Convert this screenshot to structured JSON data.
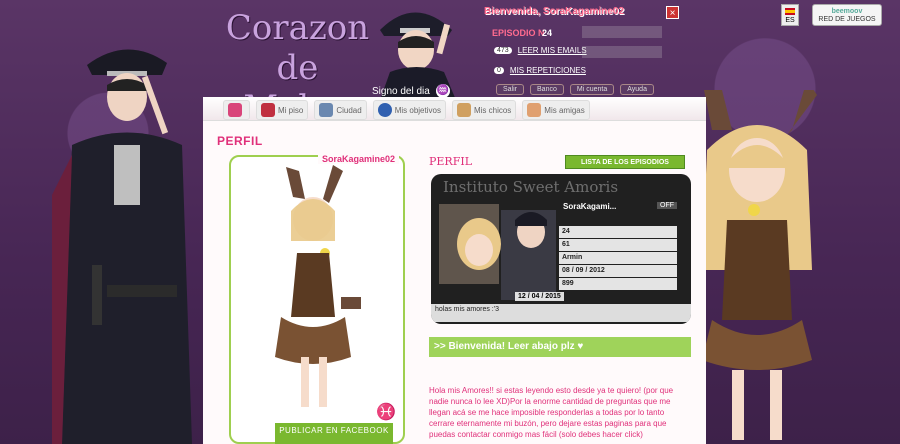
{
  "logo": {
    "line1": "Corazon de",
    "line2": "Melon"
  },
  "signo": {
    "label": "Signo del dia",
    "icon": "aquarius-icon"
  },
  "userpanel": {
    "welcome": "Bienvenida, SoraKagamine02",
    "episode_label": "EPISODIO N",
    "episode_num": "24",
    "emails_count": "473",
    "emails_label": "LEER MIS EMAILS",
    "reps_count": "0",
    "reps_label": "MIS REPETICIONES",
    "mini_buttons": [
      "Salir",
      "Banco",
      "Mi cuenta",
      "Ayuda"
    ]
  },
  "lang": {
    "code": "ES"
  },
  "beemoov": {
    "brand": "beemoov",
    "label": "RED DE JUEGOS"
  },
  "nav": {
    "tabs": [
      {
        "label": "",
        "color": "#d9457a"
      },
      {
        "label": "Mi piso",
        "color": "#c03040"
      },
      {
        "label": "Ciudad",
        "color": "#6a88b0"
      },
      {
        "label": "Mis objetivos",
        "color": "#3060b0"
      },
      {
        "label": "Mis chicos",
        "color": "#d0a060"
      },
      {
        "label": "Mis amigas",
        "color": "#e0a070"
      }
    ]
  },
  "profile": {
    "header": "PERFIL",
    "username": "SoraKagamine02",
    "publish": "PUBLICAR EN FACEBOOK",
    "subheader": "PERFIL",
    "lista": "LISTA DE LOS EPISODIOS",
    "box_title": "Instituto Sweet Amoris",
    "box_name": "SoraKagami...",
    "box_off": "OFF",
    "stats": [
      "24",
      "61",
      "Armin",
      "08 / 09 / 2012",
      "899"
    ],
    "date": "12 / 04 / 2015",
    "status": "holas mis amores :'3",
    "welcome_bar": ">> Bienvenida! Leer abajo plz ♥",
    "intro": "Hola mis Amores!! si estas leyendo esto desde ya te quiero! (por que nadie nunca lo lee XD)Por la enorme cantidad de preguntas que me llegan acá se me hace imposible responderlas a todas por lo tanto cerrare eternamente mi buzón, pero dejare estas paginas para que puedas contactar conmigo mas fácil (solo debes hacer click)"
  }
}
